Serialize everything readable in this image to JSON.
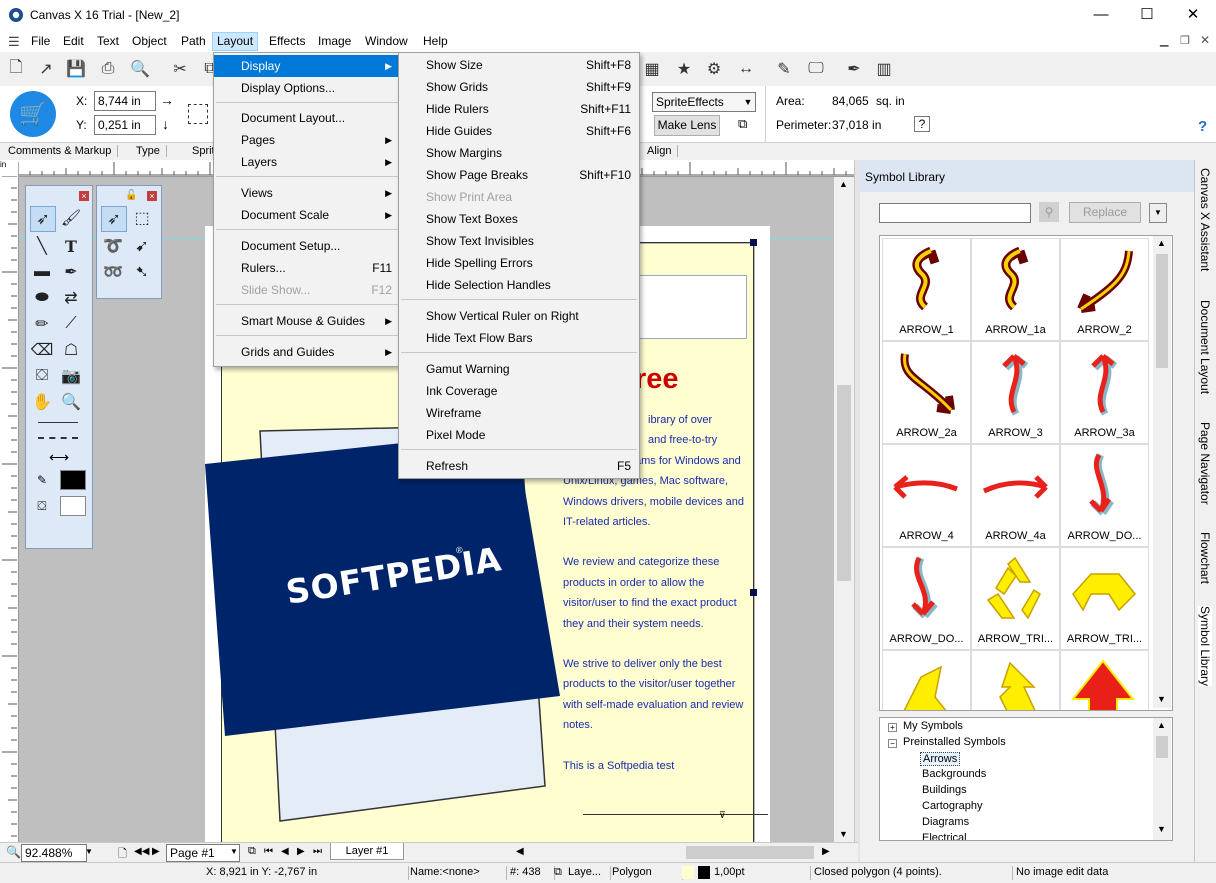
{
  "window": {
    "title": "Canvas X 16 Trial - [New_2]",
    "controls": [
      "—",
      "☐",
      "✕"
    ]
  },
  "menubar": {
    "items": [
      "File",
      "Edit",
      "Text",
      "Object",
      "Path",
      "Layout",
      "Effects",
      "Image",
      "Window",
      "Help"
    ],
    "active": "Layout"
  },
  "props": {
    "x_label": "X:",
    "x_value": "8,744 in",
    "y_label": "Y:",
    "y_value": "0,251 in",
    "effect_select": "SpriteEffects",
    "make_lens": "Make Lens",
    "area_label": "Area:",
    "area_value": "84,065",
    "area_unit": "sq. in",
    "perimeter_label": "Perimeter:",
    "perimeter_value": "37,018 in",
    "help": "?"
  },
  "panel_tabs": [
    "Comments & Markup",
    "Type",
    "Sprit",
    "Align"
  ],
  "layout_menu": {
    "items": [
      {
        "label": "Display",
        "submenu": true,
        "highlighted": true
      },
      {
        "label": "Display Options..."
      },
      {
        "label": "Document Layout..."
      },
      {
        "label": "Pages",
        "submenu": true
      },
      {
        "label": "Layers",
        "submenu": true
      },
      {
        "label": "Views",
        "submenu": true
      },
      {
        "label": "Document Scale",
        "submenu": true
      },
      {
        "label": "Document Setup..."
      },
      {
        "label": "Rulers...",
        "shortcut": "F11"
      },
      {
        "label": "Slide Show...",
        "shortcut": "F12",
        "disabled": true
      },
      {
        "label": "Smart Mouse & Guides",
        "submenu": true
      },
      {
        "label": "Grids and Guides",
        "submenu": true
      }
    ]
  },
  "display_menu": {
    "items": [
      {
        "label": "Show Size",
        "shortcut": "Shift+F8"
      },
      {
        "label": "Show Grids",
        "shortcut": "Shift+F9"
      },
      {
        "label": "Hide Rulers",
        "shortcut": "Shift+F11"
      },
      {
        "label": "Hide Guides",
        "shortcut": "Shift+F6"
      },
      {
        "label": "Show Margins",
        "shortcut": ""
      },
      {
        "label": "Show Page Breaks",
        "shortcut": "Shift+F10"
      },
      {
        "label": "Show Print Area",
        "shortcut": "",
        "disabled": true
      },
      {
        "label": "Show Text Boxes",
        "shortcut": ""
      },
      {
        "label": "Show Text Invisibles",
        "shortcut": ""
      },
      {
        "label": "Hide Spelling Errors",
        "shortcut": ""
      },
      {
        "label": "Hide Selection Handles",
        "shortcut": ""
      },
      {
        "label": "Show Vertical Ruler on Right",
        "shortcut": ""
      },
      {
        "label": "Hide Text Flow Bars",
        "shortcut": ""
      },
      {
        "label": "Gamut Warning",
        "shortcut": ""
      },
      {
        "label": "Ink Coverage",
        "shortcut": ""
      },
      {
        "label": "Wireframe",
        "shortcut": ""
      },
      {
        "label": "Pixel Mode",
        "shortcut": ""
      },
      {
        "label": "Refresh",
        "shortcut": "F5"
      }
    ]
  },
  "document": {
    "heading_fragment": "ree",
    "logo_text": "SOFTPEDIA",
    "paragraphs": [
      [
        "ibrary of over",
        "and free-to-try",
        "ams for Windows and",
        "Unix/Linux, games, Mac software,",
        "Windows drivers, mobile devices and",
        "IT-related articles."
      ],
      [
        "We review and categorize these",
        "products in order to allow the",
        "visitor/user to find the exact product",
        "they and their system needs."
      ],
      [
        "We strive to deliver only the best",
        "products to the visitor/user together",
        "with self-made evaluation and review",
        "notes."
      ],
      [
        "This is a Softpedia test"
      ]
    ]
  },
  "symbol_library": {
    "title": "Symbol Library",
    "search_value": "",
    "replace_button": "Replace",
    "symbols": [
      "ARROW_1",
      "ARROW_1a",
      "ARROW_2",
      "ARROW_2a",
      "ARROW_3",
      "ARROW_3a",
      "ARROW_4",
      "ARROW_4a",
      "ARROW_DO...",
      "ARROW_DO...",
      "ARROW_TRI...",
      "ARROW_TRI...",
      "",
      "",
      ""
    ],
    "tree": {
      "my_symbols": "My Symbols",
      "preinstalled": "Preinstalled Symbols",
      "children": [
        "Arrows",
        "Backgrounds",
        "Buildings",
        "Cartography",
        "Diagrams",
        "Electrical"
      ],
      "selected": "Arrows"
    },
    "side_tabs": [
      "Canvas X Assistant",
      "Document Layout",
      "Page Navigator",
      "Flowchart",
      "Symbol Library"
    ]
  },
  "bottom": {
    "zoom": "92.488%",
    "page_select": "Page #1",
    "layer_tab": "Layer #1"
  },
  "statusbar": {
    "coords": "X: 8,921 in  Y: -2,767 in",
    "name": "Name:<none>",
    "id": "#: 438",
    "layer": "Laye...",
    "type": "Polygon",
    "stroke": "1,00pt",
    "desc": "Closed polygon (4 points).",
    "image": "No image edit data"
  },
  "colors": {
    "accent": "#0078d7",
    "menu_active_bg": "#cce8ff",
    "logo_bg": "#002469",
    "body_text": "#1a2bb0",
    "heading": "#cc0000",
    "page_yellow": "#fffed0"
  }
}
